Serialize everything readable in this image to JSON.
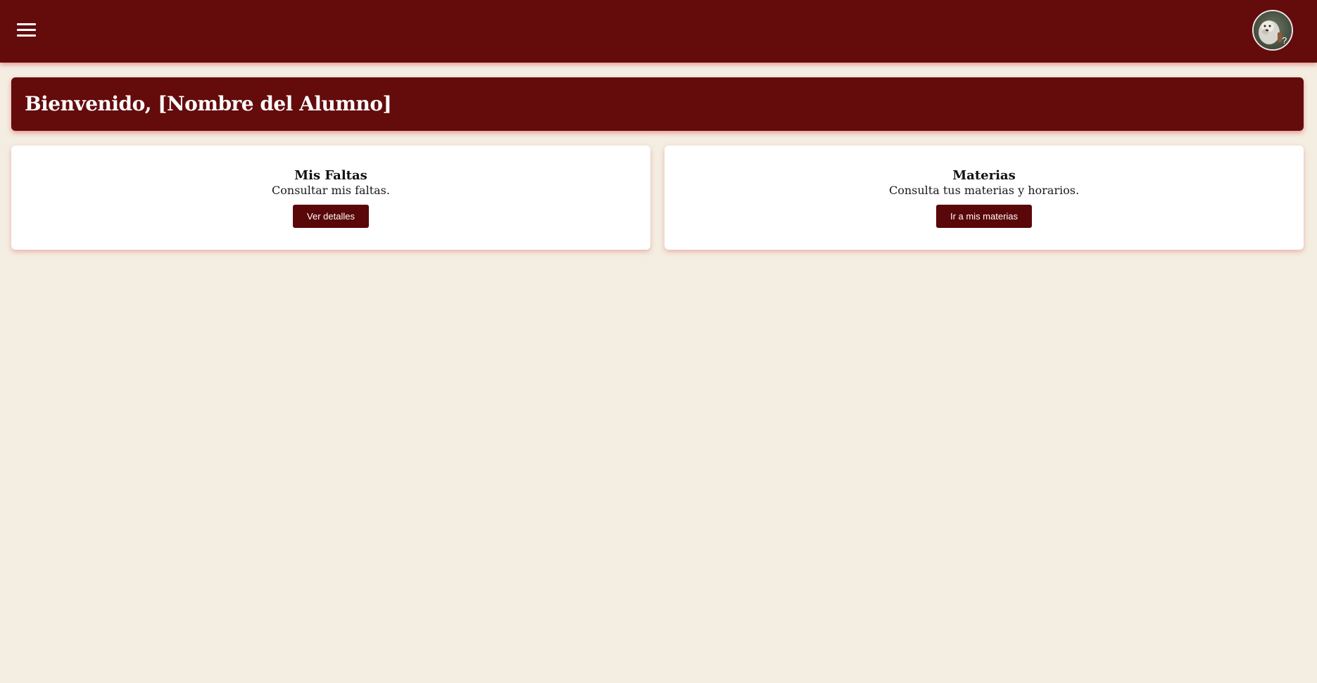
{
  "header": {
    "menu_icon": "hamburger-menu-icon",
    "avatar_icon": "user-avatar-photo",
    "avatar_badge": "?"
  },
  "welcome": {
    "title": "Bienvenido, [Nombre del Alumno]"
  },
  "cards": [
    {
      "title": "Mis Faltas",
      "description": "Consultar mis faltas.",
      "button_label": "Ver detalles"
    },
    {
      "title": "Materias",
      "description": "Consulta tus materias y horarios.",
      "button_label": "Ir a mis materias"
    }
  ],
  "colors": {
    "primary": "#640b0c",
    "button": "#5a0709",
    "background": "#f4ede1",
    "card": "#ffffff"
  }
}
